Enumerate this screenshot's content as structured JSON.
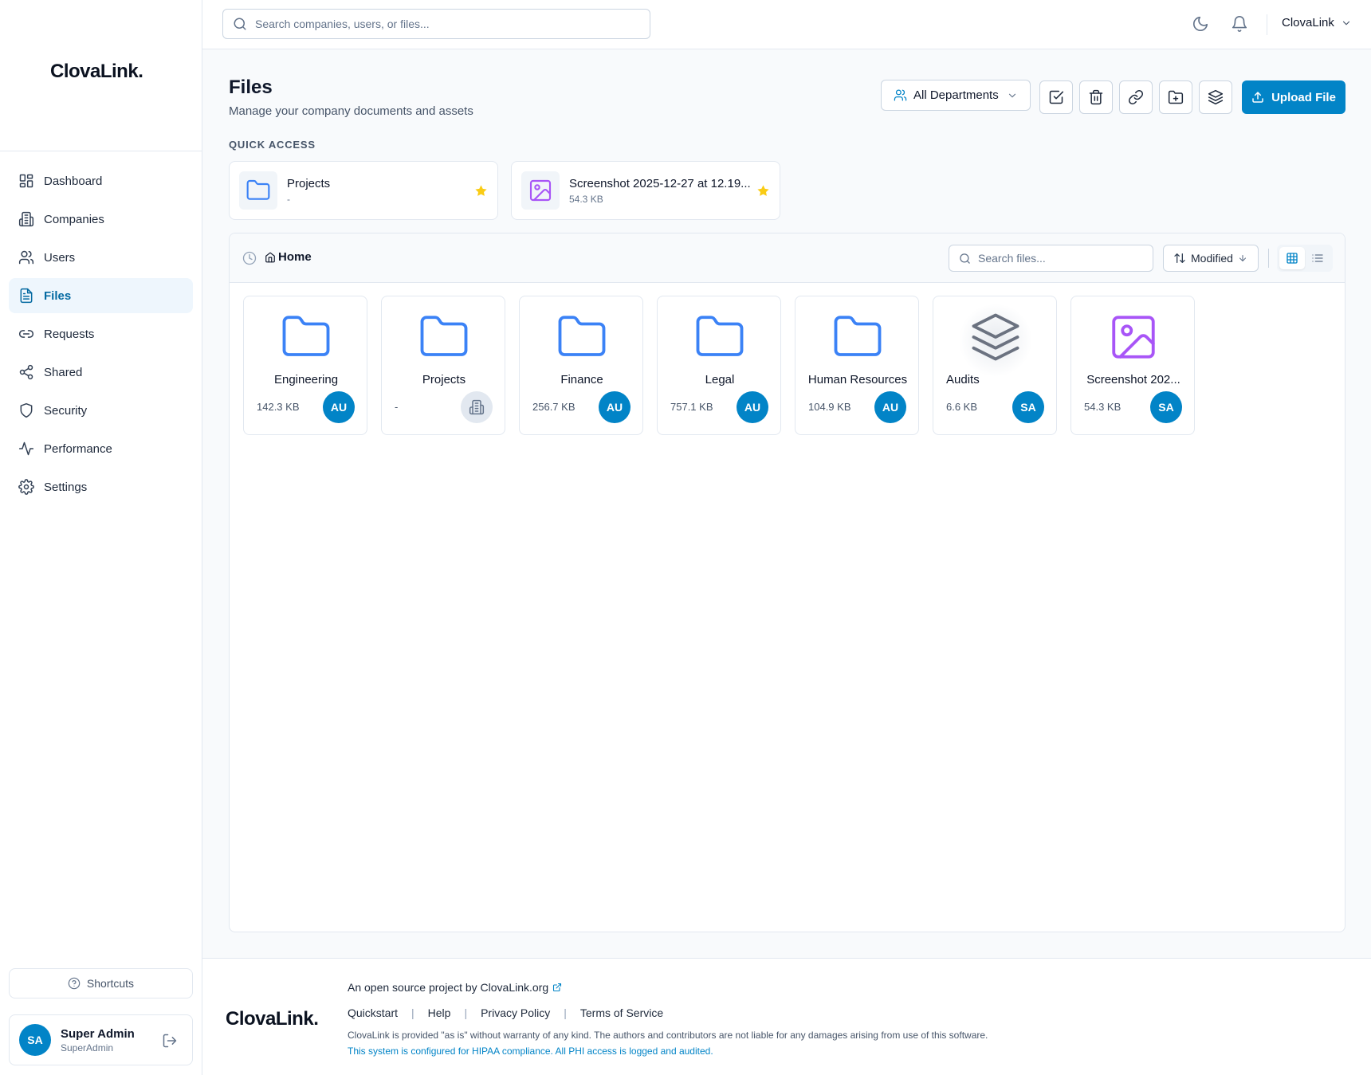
{
  "app": {
    "logo_text": "ClovaLink.",
    "org_name": "ClovaLink"
  },
  "sidebar": {
    "items": [
      {
        "label": "Dashboard",
        "icon": "dashboard-icon"
      },
      {
        "label": "Companies",
        "icon": "building-icon"
      },
      {
        "label": "Users",
        "icon": "users-icon"
      },
      {
        "label": "Files",
        "icon": "file-icon",
        "active": true
      },
      {
        "label": "Requests",
        "icon": "link-icon"
      },
      {
        "label": "Shared",
        "icon": "share-icon"
      },
      {
        "label": "Security",
        "icon": "shield-icon"
      },
      {
        "label": "Performance",
        "icon": "activity-icon"
      },
      {
        "label": "Settings",
        "icon": "gear-icon"
      }
    ],
    "shortcuts_label": "Shortcuts",
    "user": {
      "initials": "SA",
      "name": "Super Admin",
      "role": "SuperAdmin"
    }
  },
  "topbar": {
    "search_placeholder": "Search companies, users, or files..."
  },
  "page": {
    "title": "Files",
    "subtitle": "Manage your company documents and assets",
    "department_filter": "All Departments",
    "upload_label": "Upload File",
    "accent_color": "#0284c7"
  },
  "quick_access": {
    "title": "QUICK ACCESS",
    "items": [
      {
        "name": "Projects",
        "size": "-",
        "type": "folder",
        "starred": true
      },
      {
        "name": "Screenshot 2025-12-27 at 12.19...",
        "size": "54.3 KB",
        "type": "image",
        "starred": true
      }
    ]
  },
  "browser": {
    "breadcrumb": "Home",
    "search_placeholder": "Search files...",
    "sort_label": "Modified",
    "view_mode": "grid",
    "items": [
      {
        "name": "Engineering",
        "size": "142.3 KB",
        "owner": "AU",
        "type": "folder"
      },
      {
        "name": "Projects",
        "size": "-",
        "owner": "",
        "type": "folder",
        "owner_icon": "building-icon"
      },
      {
        "name": "Finance",
        "size": "256.7 KB",
        "owner": "AU",
        "type": "folder"
      },
      {
        "name": "Legal",
        "size": "757.1 KB",
        "owner": "AU",
        "type": "folder"
      },
      {
        "name": "Human Resources",
        "size": "104.9 KB",
        "owner": "AU",
        "type": "folder"
      },
      {
        "name": "Audits",
        "size": "6.6 KB",
        "owner": "SA",
        "type": "stack"
      },
      {
        "name": "Screenshot 202...",
        "size": "54.3 KB",
        "owner": "SA",
        "type": "image"
      }
    ]
  },
  "footer": {
    "logo_text": "ClovaLink.",
    "project_line": "An open source project by ClovaLink.org",
    "links": [
      "Quickstart",
      "Help",
      "Privacy Policy",
      "Terms of Service"
    ],
    "disclaimer": "ClovaLink is provided \"as is\" without warranty of any kind. The authors and contributors are not liable for any damages arising from use of this software.",
    "hipaa": "This system is configured for HIPAA compliance. All PHI access is logged and audited."
  }
}
